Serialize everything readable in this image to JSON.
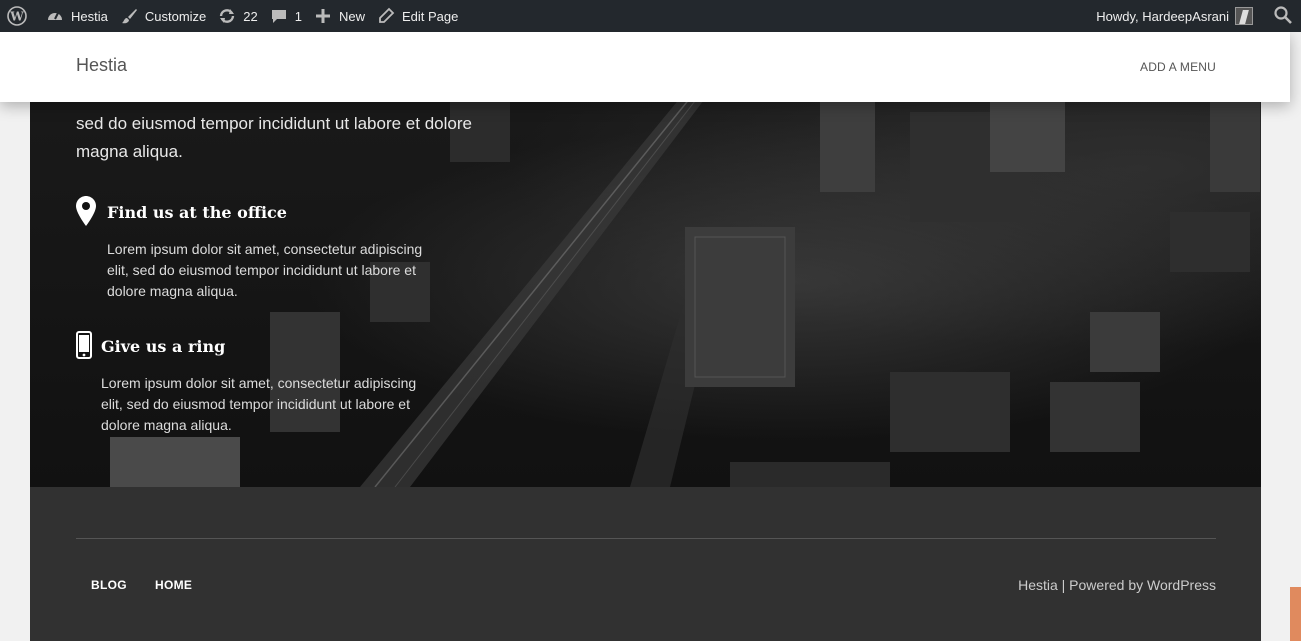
{
  "adminbar": {
    "site_name": "Hestia",
    "customize": "Customize",
    "updates_count": "22",
    "comments_count": "1",
    "new_label": "New",
    "edit_label": "Edit Page",
    "howdy": "Howdy, HardeepAsrani"
  },
  "header": {
    "brand": "Hestia",
    "menu_label": "ADD A MENU"
  },
  "contact": {
    "lead_text": "sed do eiusmod tempor incididunt ut labore et dolore magna aliqua.",
    "items": [
      {
        "title": "Find us at the office",
        "text": "Lorem ipsum dolor sit amet, consectetur adipiscing elit, sed do eiusmod tempor incididunt ut labore et dolore magna aliqua.",
        "icon": "map-marker-icon"
      },
      {
        "title": "Give us a ring",
        "text": "Lorem ipsum dolor sit amet, consectetur adipiscing elit, sed do eiusmod tempor incididunt ut labore et dolore magna aliqua.",
        "icon": "mobile-phone-icon"
      }
    ]
  },
  "footer": {
    "nav": [
      "BLOG",
      "HOME"
    ],
    "copyright_site": "Hestia",
    "copyright_sep": " | Powered by ",
    "copyright_link": "WordPress"
  },
  "colors": {
    "adminbar_bg": "#23282d",
    "footer_bg": "#313131",
    "scroll_accent": "#e08a5e"
  }
}
